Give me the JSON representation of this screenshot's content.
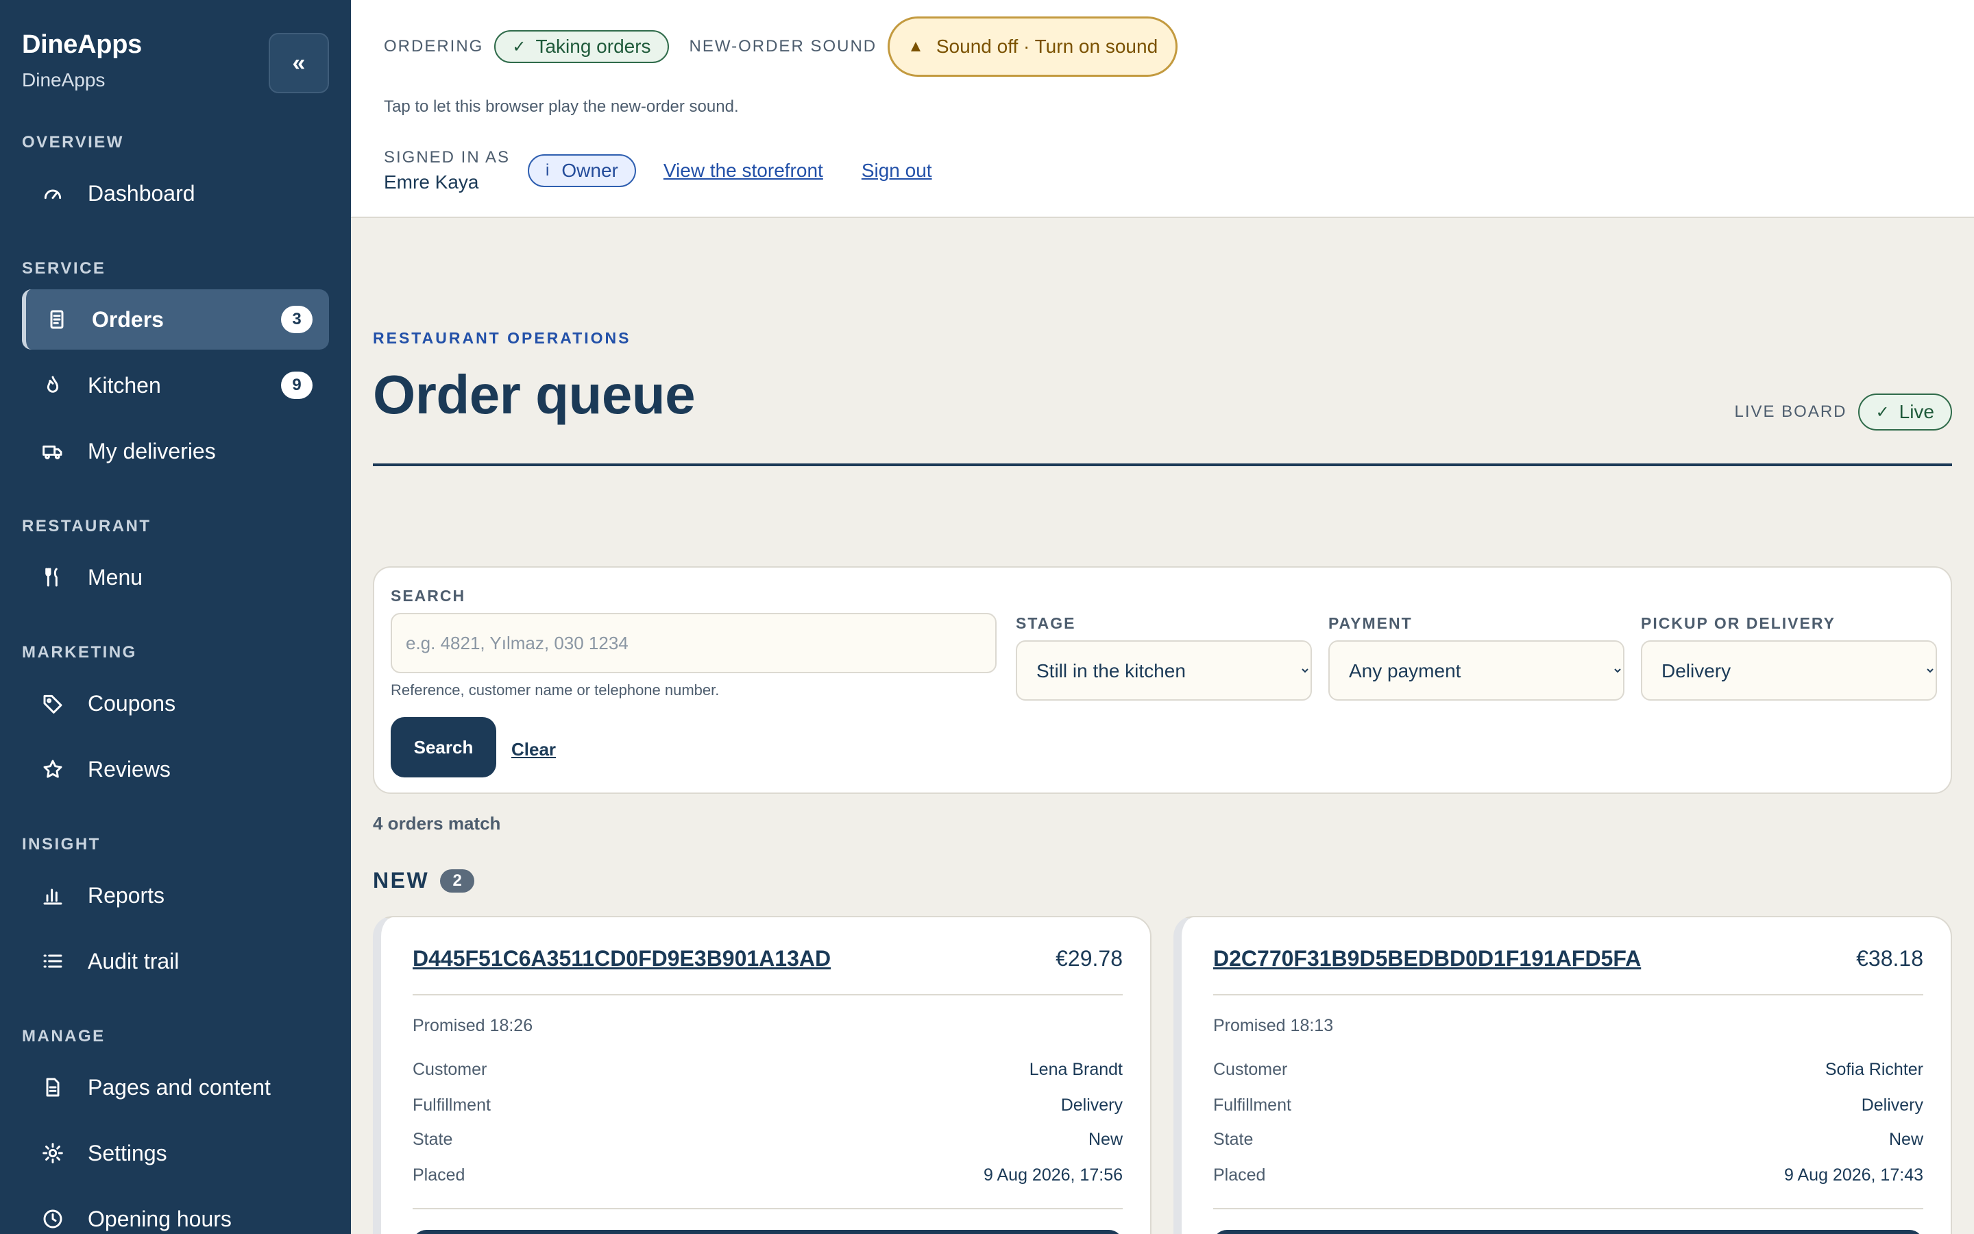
{
  "sidebar": {
    "brand_title": "DineApps",
    "brand_subtitle": "DineApps",
    "collapse_label": "«",
    "groups": [
      {
        "label": "OVERVIEW"
      },
      {
        "label": "SERVICE"
      },
      {
        "label": "RESTAURANT"
      },
      {
        "label": "MARKETING"
      },
      {
        "label": "INSIGHT"
      },
      {
        "label": "MANAGE"
      }
    ],
    "items": [
      {
        "label": "Dashboard",
        "icon": "gauge-icon"
      },
      {
        "label": "Orders",
        "icon": "receipt-icon",
        "badge": "3",
        "active": true
      },
      {
        "label": "Kitchen",
        "icon": "flame-icon",
        "badge": "9"
      },
      {
        "label": "My deliveries",
        "icon": "truck-icon"
      },
      {
        "label": "Menu",
        "icon": "utensils-icon"
      },
      {
        "label": "Coupons",
        "icon": "tag-icon"
      },
      {
        "label": "Reviews",
        "icon": "star-icon"
      },
      {
        "label": "Reports",
        "icon": "bar-chart-icon"
      },
      {
        "label": "Audit trail",
        "icon": "list-icon"
      },
      {
        "label": "Pages and content",
        "icon": "document-icon"
      },
      {
        "label": "Settings",
        "icon": "gear-icon"
      },
      {
        "label": "Opening hours",
        "icon": "clock-icon"
      }
    ]
  },
  "header": {
    "ordering_label": "ORDERING",
    "ordering_status": "Taking orders",
    "sound_label": "NEW-ORDER SOUND",
    "sound_button": "Sound off · Turn on sound",
    "sound_hint": "Tap to let this browser play the new-order sound.",
    "signed_in_label": "SIGNED IN AS",
    "user_name": "Emre Kaya",
    "role": "Owner",
    "storefront_link": "View the storefront",
    "signout_link": "Sign out"
  },
  "main": {
    "eyebrow": "RESTAURANT OPERATIONS",
    "title": "Order queue",
    "live_board_label": "LIVE BOARD",
    "live_status": "Live"
  },
  "filters": {
    "search_label": "SEARCH",
    "search_placeholder": "e.g. 4821, Yılmaz, 030 1234",
    "search_value": "",
    "search_help": "Reference, customer name or telephone number.",
    "stage_label": "STAGE",
    "stage_value": "Still in the kitchen",
    "payment_label": "PAYMENT",
    "payment_value": "Any payment",
    "fulfillment_label": "PICKUP OR DELIVERY",
    "fulfillment_value": "Delivery",
    "search_button": "Search",
    "clear_link": "Clear"
  },
  "results": {
    "match_count": "4 orders match",
    "section_title": "NEW",
    "section_count": "2",
    "orders": [
      {
        "reference": "D445F51C6A3511CD0FD9E3B901A13AD",
        "total": "€29.78",
        "promised": "Promised 18:26",
        "rows": [
          {
            "k": "Customer",
            "v": "Lena Brandt"
          },
          {
            "k": "Fulfillment",
            "v": "Delivery"
          },
          {
            "k": "State",
            "v": "New"
          },
          {
            "k": "Placed",
            "v": "9 Aug 2026, 17:56"
          }
        ]
      },
      {
        "reference": "D2C770F31B9D5BEDBD0D1F191AFD5FA",
        "total": "€38.18",
        "promised": "Promised 18:13",
        "rows": [
          {
            "k": "Customer",
            "v": "Sofia Richter"
          },
          {
            "k": "Fulfillment",
            "v": "Delivery"
          },
          {
            "k": "State",
            "v": "New"
          },
          {
            "k": "Placed",
            "v": "9 Aug 2026, 17:43"
          }
        ]
      }
    ]
  },
  "colors": {
    "sidebar_bg": "#1c3a57",
    "accent_blue": "#2250a8",
    "success_green": "#1f5a3a",
    "warning_amber": "#7a5100",
    "page_bg": "#f1efe9"
  }
}
